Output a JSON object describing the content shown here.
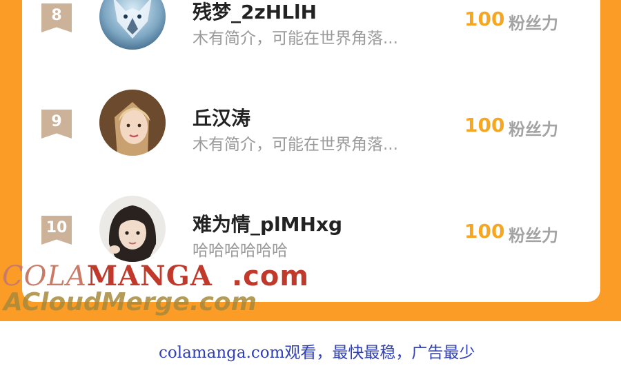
{
  "ranking": {
    "rows": [
      {
        "rank": "8",
        "name": "残梦_2zHLlH",
        "bio": "木有简介，可能在世界角落...",
        "fans": "100",
        "fans_label": "粉丝力"
      },
      {
        "rank": "9",
        "name": "丘汉涛",
        "bio": "木有简介，可能在世界角落...",
        "fans": "100",
        "fans_label": "粉丝力"
      },
      {
        "rank": "10",
        "name": "难为情_plMHxg",
        "bio": "哈哈哈哈哈哈",
        "fans": "100",
        "fans_label": "粉丝力"
      }
    ]
  },
  "watermark": {
    "brand_part1": "COLA",
    "brand_part2": "MANGA",
    "brand_part3": ".com",
    "subline": "ACloudMerge.com"
  },
  "footer": {
    "text": "colamanga.com观看，最快最稳，广告最少"
  },
  "colors": {
    "accent": "#fb9c26",
    "fans_number": "#f5a623",
    "rank_badge": "#cdb29a",
    "footer_text": "#2f3fb7"
  }
}
